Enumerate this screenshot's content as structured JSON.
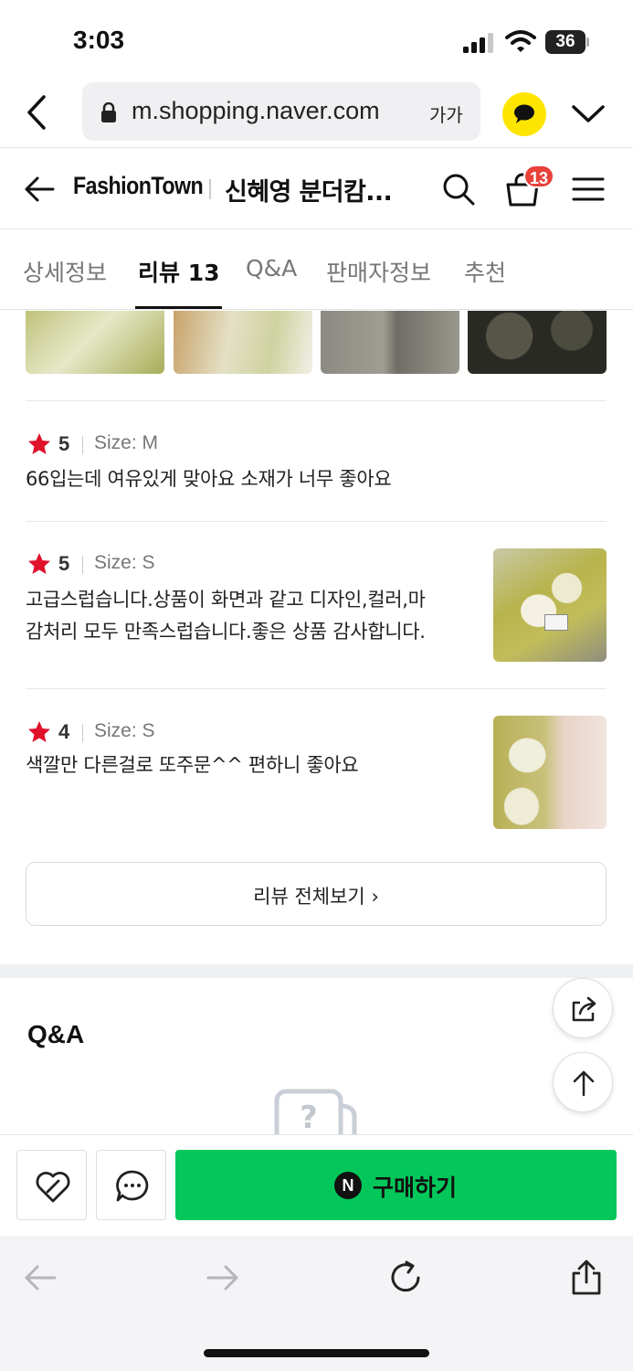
{
  "status_bar": {
    "time": "3:03",
    "battery": "36"
  },
  "browser": {
    "url": "m.shopping.naver.com",
    "text_size_label": "가가"
  },
  "store_header": {
    "brand": "FashionTown",
    "product_title": "신혜영 분더캄...",
    "cart_count": "13"
  },
  "tabs": [
    {
      "label": "상세정보",
      "active": false
    },
    {
      "label": "리뷰 13",
      "active": true
    },
    {
      "label": "Q&A",
      "active": false
    },
    {
      "label": "판매자정보",
      "active": false
    },
    {
      "label": "추천",
      "active": false
    }
  ],
  "reviews": [
    {
      "score": "5",
      "size": "Size: M",
      "lines": [
        "66입는데 여유있게 맞아요 소재가 너무 좋아요"
      ],
      "has_photo": false
    },
    {
      "score": "5",
      "size": "Size: S",
      "lines": [
        "고급스럽습니다.상품이 화면과 같고 디자인,컬러,마",
        "감처리 모두 만족스럽습니다.좋은 상품 감사합니다."
      ],
      "has_photo": true
    },
    {
      "score": "4",
      "size": "Size: S",
      "lines": [
        "색깔만 다른걸로 또주문^^ 편하니 좋아요"
      ],
      "has_photo": true
    }
  ],
  "see_all_reviews": "리뷰 전체보기",
  "qa": {
    "title": "Q&A"
  },
  "purchase": {
    "buy_label": "구매하기",
    "naver_logo": "N"
  },
  "colors": {
    "buy_green": "#03c75a",
    "star_red": "#e0112b",
    "badge_red": "#e8413a",
    "kakao_yellow": "#fee500"
  },
  "icons": [
    "back-chevron-icon",
    "lock-icon",
    "kakaotalk-icon",
    "chevron-down-icon",
    "arrow-left-icon",
    "search-icon",
    "cart-icon",
    "menu-icon",
    "star-icon",
    "share-icon",
    "arrow-up-icon",
    "heart-icon",
    "chat-icon",
    "forward-icon",
    "reload-icon"
  ]
}
